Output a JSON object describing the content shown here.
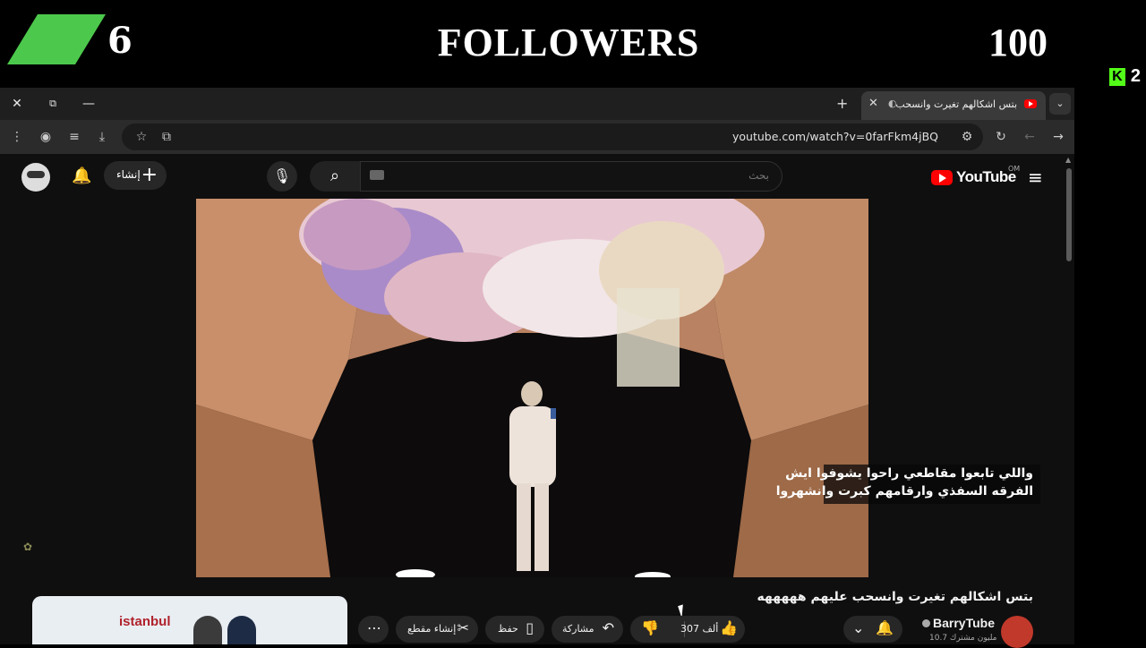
{
  "overlay": {
    "left_number": "6",
    "title": "FOLLOWERS",
    "right_number": "100",
    "kick_count": "2",
    "accent_color": "#4cc94c"
  },
  "browser": {
    "tab_title": "بتس اشكالهم تغيرت وانسحب",
    "url": "youtube.com/watch?v=0farFkm4jBQ"
  },
  "youtube": {
    "logo_text": "YouTube",
    "country_code": "OM",
    "search_placeholder": "بحث",
    "create_label": "إنشاء",
    "video": {
      "subtitle_line_1": "واللي تابعوا مقاطعي راحوا يشوفوا ايش",
      "subtitle_line_2": "الفرقه السفذي وارقامهم كبرت وانشهروا"
    },
    "video_title": "بتس اشكالهم تغيرت وانسحب عليهم هههههه",
    "channel_name": "BarryTube",
    "subscriber_count": "10.7 مليون مشترك",
    "like_count": "307 ألف",
    "share_label": "مشاركة",
    "save_label": "حفظ",
    "clip_label": "إنشاء مقطع",
    "thumb_text": "istanbul",
    "brand_color": "#ff0000"
  }
}
